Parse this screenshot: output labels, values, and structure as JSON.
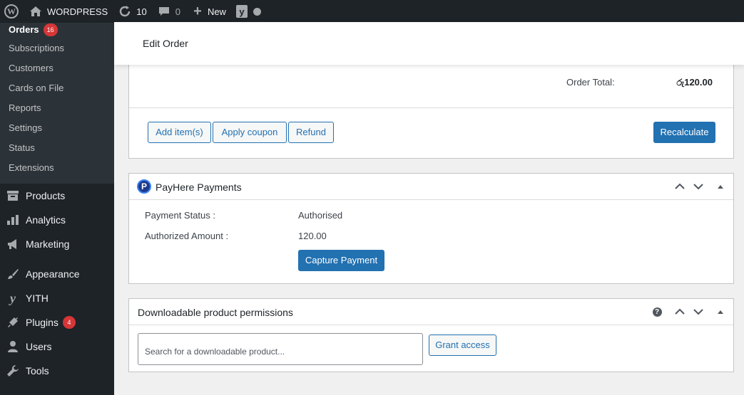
{
  "adminbar": {
    "site_name": "WORDPRESS",
    "updates_count": "10",
    "comments_count": "0",
    "new_label": "New"
  },
  "sidebar": {
    "submenu": [
      {
        "label": "Orders",
        "badge": "16"
      },
      {
        "label": "Subscriptions"
      },
      {
        "label": "Customers"
      },
      {
        "label": "Cards on File"
      },
      {
        "label": "Reports"
      },
      {
        "label": "Settings"
      },
      {
        "label": "Status"
      },
      {
        "label": "Extensions"
      }
    ],
    "menu": [
      {
        "label": "Products",
        "icon": "archive-icon"
      },
      {
        "label": "Analytics",
        "icon": "bar-chart-icon"
      },
      {
        "label": "Marketing",
        "icon": "megaphone-icon"
      },
      {
        "label": "Appearance",
        "icon": "brush-icon"
      },
      {
        "label": "YITH",
        "icon": "yith-icon"
      },
      {
        "label": "Plugins",
        "icon": "plug-icon",
        "badge": "4"
      },
      {
        "label": "Users",
        "icon": "user-icon"
      },
      {
        "label": "Tools",
        "icon": "wrench-icon"
      }
    ]
  },
  "header": {
    "title": "Edit Order"
  },
  "order_items": {
    "total_label": "Order Total:",
    "total_value": "රු120.00",
    "buttons": {
      "add_items": "Add item(s)",
      "apply_coupon": "Apply coupon",
      "refund": "Refund",
      "recalculate": "Recalculate"
    }
  },
  "payhere": {
    "title": "PayHere Payments",
    "status_label": "Payment Status :",
    "status_value": "Authorised",
    "amount_label": "Authorized Amount :",
    "amount_value": "120.00",
    "capture_button": "Capture Payment"
  },
  "downloads": {
    "title": "Downloadable product permissions",
    "search_placeholder": "Search for a downloadable product...",
    "grant_button": "Grant access"
  },
  "colors": {
    "accent": "#2271b1",
    "badge": "#d63638",
    "sidebar": "#1d2327"
  }
}
